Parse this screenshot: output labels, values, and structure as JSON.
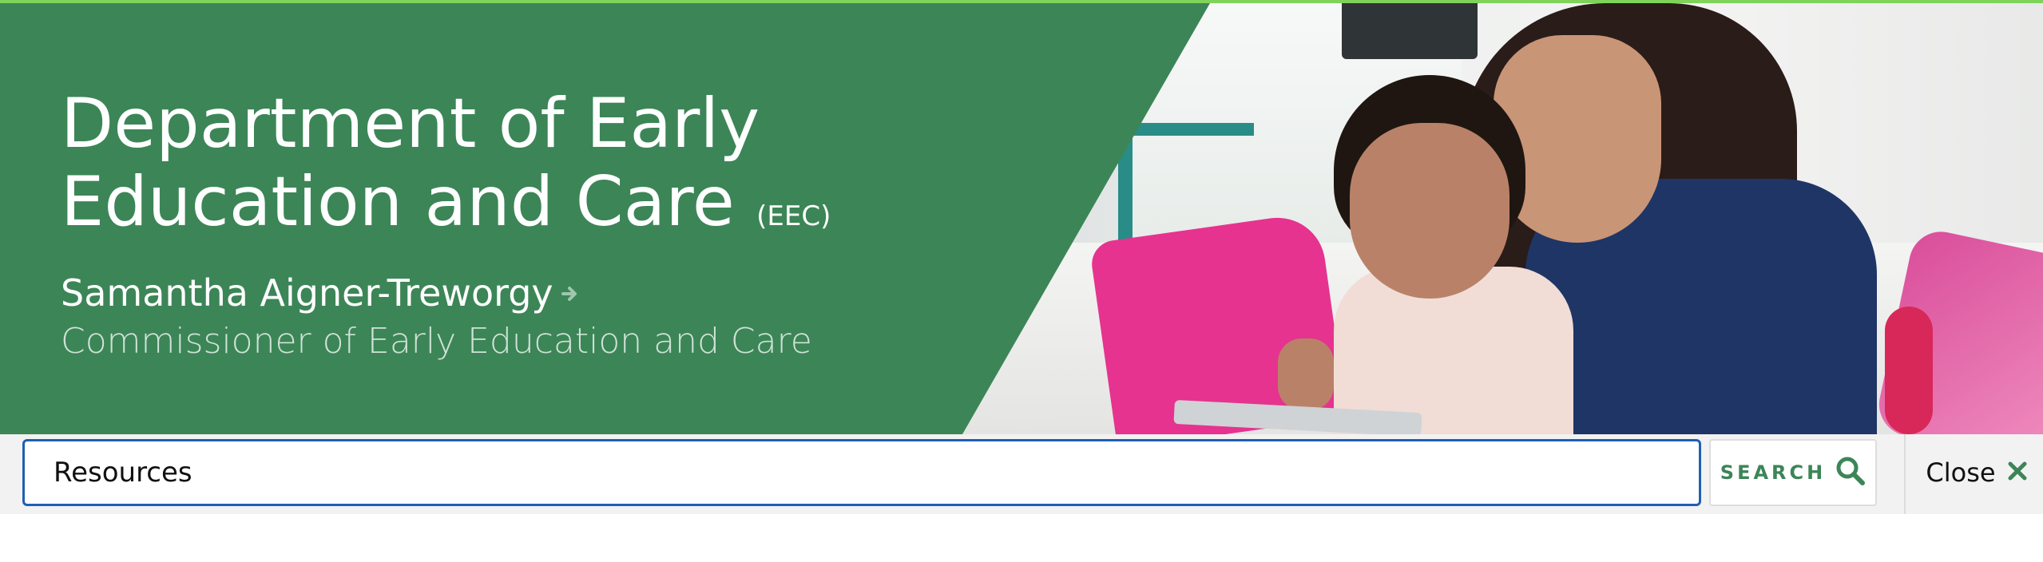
{
  "header": {
    "title_line1": "Department of Early",
    "title_line2": "Education and Care",
    "title_abbr": "(EEC)",
    "person_name": "Samantha Aigner-Treworgy",
    "person_role": "Commissioner of Early Education and Care"
  },
  "search": {
    "value": "Resources",
    "button_label": "SEARCH",
    "close_label": "Close"
  },
  "colors": {
    "panel_green": "#3c8557",
    "input_border": "#1f5fb5",
    "accent_line": "#7fd35a"
  },
  "icons": {
    "search": "search-icon",
    "close": "close-icon",
    "arrow": "arrow-right-icon"
  }
}
